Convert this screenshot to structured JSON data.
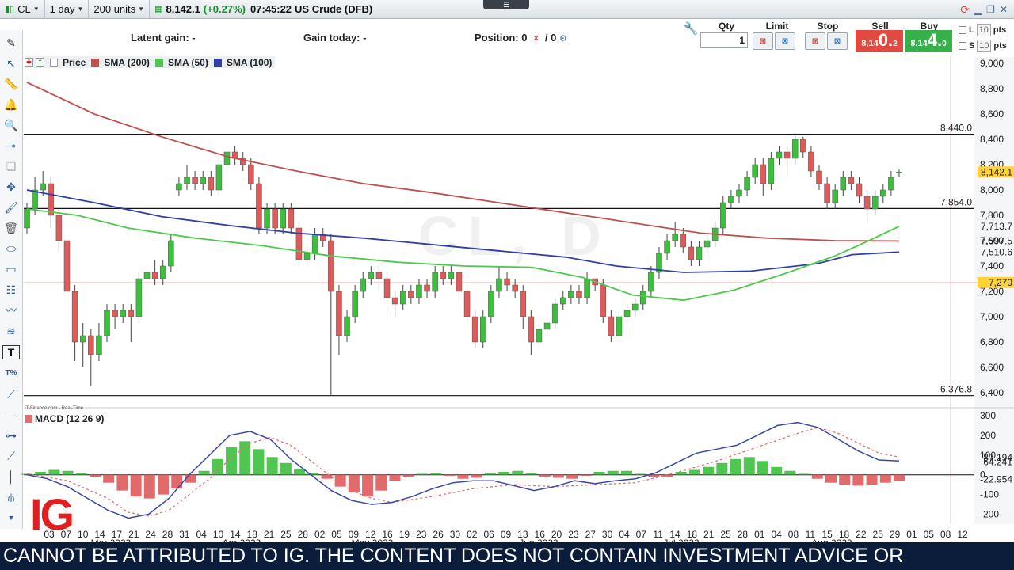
{
  "toolbar": {
    "symbol": "CL",
    "interval": "1 day",
    "units": "200 units",
    "price": "8,142.1",
    "change": "(+0.27%)",
    "time": "07:45:22",
    "market_name": "US Crude (DFB)"
  },
  "info": {
    "latent_gain": "Latent gain: -",
    "gain_today": "Gain today: -",
    "position_label": "Position: 0",
    "position_suffix": "/ 0"
  },
  "deal": {
    "qty_label": "Qty",
    "qty_value": "1",
    "limit_label": "Limit",
    "stop_label": "Stop",
    "sell_label": "Sell",
    "buy_label": "Buy",
    "sell_prefix": "8,14",
    "sell_big": "0.",
    "sell_sup": "2",
    "buy_prefix": "8,14",
    "buy_big": "4.",
    "buy_sup": "0",
    "l_label": "L",
    "s_label": "S",
    "l_value": "10",
    "s_value": "10",
    "pts": "pts"
  },
  "legend": {
    "price": "Price",
    "sma200": "SMA (200)",
    "sma50": "SMA (50)",
    "sma100": "SMA (100)",
    "macd": "MACD (12 26 9)",
    "source": "IT-Finance.com - Real-Time"
  },
  "colors": {
    "up": "#3cc03c",
    "down": "#e05a5a",
    "sma200": "#c0504d",
    "sma50": "#4cc94c",
    "sma100": "#3040a8",
    "macd_line": "#3a48a8",
    "signal_line": "#e07070",
    "accent_red": "#e04a43",
    "accent_green": "#35b04a"
  },
  "watermark": "CL, D",
  "brand": "IG",
  "ticker": "CANNOT BE ATTRIBUTED TO IG. THE CONTENT DOES NOT CONTAIN INVESTMENT ADVICE OR",
  "chart_data": {
    "type": "candlestick",
    "title": "",
    "ylim": [
      6300,
      9050
    ],
    "y_ticks": [
      6400,
      6600,
      6800,
      7000,
      7200,
      7400,
      7600,
      7800,
      8000,
      8200,
      8400,
      8600,
      8800,
      9000
    ],
    "y_tick_labels": [
      "6,400",
      "6,600",
      "6,800",
      "7,000",
      "7,200",
      "7,400",
      "7,600",
      "7,800",
      "8,000",
      "8,200",
      "8,400",
      "8,600",
      "8,800",
      "9,000"
    ],
    "x_day_labels": [
      "03",
      "07",
      "10",
      "14",
      "17",
      "21",
      "24",
      "28",
      "31",
      "04",
      "10",
      "14",
      "18",
      "21",
      "25",
      "28",
      "02",
      "05",
      "09",
      "12",
      "16",
      "19",
      "23",
      "26",
      "30",
      "02",
      "06",
      "09",
      "13",
      "16",
      "20",
      "23",
      "27",
      "30",
      "04",
      "07",
      "11",
      "14",
      "18",
      "21",
      "25",
      "28",
      "01",
      "04",
      "08",
      "11",
      "15",
      "18",
      "22",
      "25",
      "29",
      "01",
      "05",
      "08",
      "12"
    ],
    "x_month_labels": [
      "Mar 2023",
      "Apr 2023",
      "May 2023",
      "Jun 2023",
      "Jul 2023",
      "Aug 2023"
    ],
    "horizontal_lines": [
      {
        "value": 8440.0,
        "label": "8,440.0"
      },
      {
        "value": 7854.0,
        "label": "7,854.0"
      },
      {
        "value": 6376.8,
        "label": "6,376.8"
      }
    ],
    "last_values": [
      {
        "name": "Price",
        "value": 8142.1,
        "label": "8,142.1"
      },
      {
        "name": "SMA (50)",
        "value": 7713.7,
        "label": "7,713.7"
      },
      {
        "name": "SMA (200)",
        "value": 7597.5,
        "label": "7,597.5"
      },
      {
        "name": "SMA (100)",
        "value": 7510.6,
        "label": "7,510.6"
      },
      {
        "name": "",
        "value": 7270,
        "label": "7,270"
      }
    ],
    "candles": [
      [
        7700,
        7850,
        7650,
        7900
      ],
      [
        7850,
        8000,
        7800,
        8100
      ],
      [
        8000,
        8050,
        7950,
        8150
      ],
      [
        8050,
        7800,
        7700,
        8100
      ],
      [
        7800,
        7600,
        7500,
        7850
      ],
      [
        7600,
        7200,
        7100,
        7650
      ],
      [
        7200,
        6800,
        6650,
        7250
      ],
      [
        6800,
        6850,
        6600,
        6950
      ],
      [
        6850,
        6700,
        6450,
        6900
      ],
      [
        6700,
        6850,
        6650,
        6950
      ],
      [
        6850,
        7050,
        6800,
        7100
      ],
      [
        7050,
        7000,
        6900,
        7100
      ],
      [
        7000,
        7050,
        6950,
        7100
      ],
      [
        7050,
        7000,
        6800,
        7100
      ],
      [
        7000,
        7300,
        6950,
        7350
      ],
      [
        7300,
        7350,
        7250,
        7400
      ],
      [
        7350,
        7300,
        7250,
        7450
      ],
      [
        7300,
        7400,
        7250,
        7450
      ],
      [
        7400,
        7600,
        7350,
        7650
      ],
      [
        8000,
        8050,
        7950,
        8100
      ],
      [
        8050,
        8100,
        8000,
        8200
      ],
      [
        8100,
        8050,
        8000,
        8150
      ],
      [
        8050,
        8100,
        8000,
        8150
      ],
      [
        8100,
        8000,
        7950,
        8150
      ],
      [
        8000,
        8200,
        7950,
        8250
      ],
      [
        8200,
        8300,
        8150,
        8350
      ],
      [
        8300,
        8250,
        8200,
        8350
      ],
      [
        8250,
        8200,
        8150,
        8300
      ],
      [
        8200,
        8050,
        8000,
        8250
      ],
      [
        8050,
        7700,
        7650,
        8100
      ],
      [
        7700,
        7850,
        7650,
        7900
      ],
      [
        7850,
        7700,
        7650,
        7900
      ],
      [
        7700,
        7850,
        7650,
        7900
      ],
      [
        7850,
        7700,
        7650,
        7900
      ],
      [
        7700,
        7450,
        7400,
        7750
      ],
      [
        7450,
        7500,
        7400,
        7550
      ],
      [
        7500,
        7650,
        7450,
        7700
      ],
      [
        7650,
        7600,
        7550,
        7700
      ],
      [
        7600,
        7200,
        6376.8,
        7650
      ],
      [
        7200,
        6850,
        6700,
        7250
      ],
      [
        6850,
        7000,
        6800,
        7050
      ],
      [
        7000,
        7200,
        6950,
        7250
      ],
      [
        7200,
        7300,
        7150,
        7350
      ],
      [
        7300,
        7350,
        7250,
        7400
      ],
      [
        7350,
        7300,
        7200,
        7400
      ],
      [
        7300,
        7150,
        7000,
        7350
      ],
      [
        7150,
        7100,
        7000,
        7200
      ],
      [
        7100,
        7200,
        7050,
        7250
      ],
      [
        7200,
        7150,
        7100,
        7250
      ],
      [
        7150,
        7250,
        7100,
        7300
      ],
      [
        7250,
        7200,
        7150,
        7300
      ],
      [
        7200,
        7350,
        7150,
        7400
      ],
      [
        7350,
        7300,
        7250,
        7400
      ],
      [
        7300,
        7350,
        7250,
        7400
      ],
      [
        7350,
        7200,
        7150,
        7400
      ],
      [
        7200,
        7000,
        6950,
        7250
      ],
      [
        7000,
        6800,
        6750,
        7050
      ],
      [
        6800,
        7000,
        6750,
        7050
      ],
      [
        7000,
        7200,
        6950,
        7250
      ],
      [
        7200,
        7300,
        7150,
        7400
      ],
      [
        7300,
        7250,
        7200,
        7350
      ],
      [
        7250,
        7200,
        7150,
        7300
      ],
      [
        7200,
        7000,
        6900,
        7250
      ],
      [
        7000,
        6800,
        6700,
        7050
      ],
      [
        6800,
        6900,
        6750,
        6950
      ],
      [
        6900,
        6950,
        6850,
        7000
      ],
      [
        6950,
        7100,
        6900,
        7150
      ],
      [
        7100,
        7150,
        7050,
        7200
      ],
      [
        7150,
        7200,
        7100,
        7250
      ],
      [
        7200,
        7150,
        7100,
        7250
      ],
      [
        7150,
        7300,
        7100,
        7350
      ],
      [
        7300,
        7250,
        7200,
        7300
      ],
      [
        7250,
        7000,
        6950,
        7300
      ],
      [
        7000,
        6850,
        6800,
        7050
      ],
      [
        6850,
        7000,
        6800,
        7050
      ],
      [
        7000,
        7050,
        6950,
        7100
      ],
      [
        7050,
        7100,
        7000,
        7150
      ],
      [
        7100,
        7200,
        7050,
        7250
      ],
      [
        7200,
        7350,
        7150,
        7400
      ],
      [
        7350,
        7500,
        7300,
        7550
      ],
      [
        7500,
        7600,
        7450,
        7650
      ],
      [
        7600,
        7650,
        7550,
        7750
      ],
      [
        7650,
        7550,
        7500,
        7700
      ],
      [
        7550,
        7450,
        7400,
        7600
      ],
      [
        7450,
        7550,
        7400,
        7600
      ],
      [
        7550,
        7600,
        7500,
        7650
      ],
      [
        7600,
        7700,
        7550,
        7750
      ],
      [
        7700,
        7900,
        7650,
        7950
      ],
      [
        7900,
        7950,
        7850,
        8000
      ],
      [
        7950,
        8000,
        7900,
        8050
      ],
      [
        8000,
        8100,
        7950,
        8150
      ],
      [
        8100,
        8200,
        8050,
        8250
      ],
      [
        8200,
        8050,
        7950,
        8250
      ],
      [
        8050,
        8250,
        8000,
        8300
      ],
      [
        8250,
        8300,
        8200,
        8350
      ],
      [
        8300,
        8250,
        8100,
        8350
      ],
      [
        8250,
        8400,
        8200,
        8450
      ],
      [
        8400,
        8300,
        8250,
        8420
      ],
      [
        8300,
        8150,
        8100,
        8350
      ],
      [
        8150,
        8050,
        8000,
        8200
      ],
      [
        8050,
        7900,
        7850,
        8100
      ],
      [
        7900,
        8000,
        7850,
        8050
      ],
      [
        8000,
        8100,
        7950,
        8150
      ],
      [
        8100,
        8050,
        8000,
        8150
      ],
      [
        8050,
        7950,
        7900,
        8100
      ],
      [
        7950,
        7850,
        7750,
        8000
      ],
      [
        7850,
        7950,
        7800,
        8000
      ],
      [
        7950,
        8000,
        7900,
        8050
      ],
      [
        8000,
        8100,
        7950,
        8150
      ],
      [
        8142.1,
        8142.1,
        8100,
        8160
      ]
    ],
    "macd": {
      "ylim": [
        -250,
        320
      ],
      "y_ticks": [
        300,
        200,
        100,
        0,
        -100,
        -200
      ],
      "last_values": [
        {
          "name": "MACD",
          "value": 64.241,
          "label": "64.241"
        },
        {
          "name": "Signal",
          "value": 87.194,
          "label": "87.194"
        },
        {
          "name": "Histogram",
          "value": -22.954,
          "label": "-22.954"
        }
      ],
      "macd_line": [
        [
          0,
          0
        ],
        [
          5,
          -20
        ],
        [
          10,
          -60
        ],
        [
          15,
          -120
        ],
        [
          20,
          -180
        ],
        [
          25,
          -220
        ],
        [
          30,
          -200
        ],
        [
          35,
          -120
        ],
        [
          40,
          0
        ],
        [
          45,
          100
        ],
        [
          50,
          200
        ],
        [
          55,
          220
        ],
        [
          60,
          180
        ],
        [
          65,
          80
        ],
        [
          70,
          0
        ],
        [
          75,
          -80
        ],
        [
          80,
          -130
        ],
        [
          85,
          -150
        ],
        [
          90,
          -140
        ],
        [
          95,
          -110
        ],
        [
          100,
          -70
        ],
        [
          105,
          -40
        ],
        [
          110,
          -30
        ],
        [
          115,
          -30
        ],
        [
          120,
          -55
        ],
        [
          125,
          -80
        ],
        [
          130,
          -60
        ],
        [
          135,
          -30
        ],
        [
          140,
          -45
        ],
        [
          145,
          -30
        ],
        [
          150,
          -20
        ],
        [
          155,
          10
        ],
        [
          160,
          60
        ],
        [
          165,
          110
        ],
        [
          170,
          130
        ],
        [
          175,
          150
        ],
        [
          180,
          200
        ],
        [
          185,
          250
        ],
        [
          190,
          265
        ],
        [
          195,
          240
        ],
        [
          200,
          180
        ],
        [
          205,
          120
        ],
        [
          210,
          75
        ],
        [
          215,
          70
        ]
      ],
      "signal_line": [
        [
          0,
          5
        ],
        [
          10,
          -30
        ],
        [
          20,
          -120
        ],
        [
          25,
          -190
        ],
        [
          30,
          -210
        ],
        [
          35,
          -180
        ],
        [
          40,
          -100
        ],
        [
          45,
          -20
        ],
        [
          50,
          80
        ],
        [
          55,
          160
        ],
        [
          60,
          190
        ],
        [
          65,
          150
        ],
        [
          70,
          70
        ],
        [
          75,
          -10
        ],
        [
          80,
          -80
        ],
        [
          85,
          -120
        ],
        [
          90,
          -140
        ],
        [
          100,
          -110
        ],
        [
          110,
          -70
        ],
        [
          120,
          -50
        ],
        [
          130,
          -60
        ],
        [
          140,
          -50
        ],
        [
          150,
          -40
        ],
        [
          160,
          10
        ],
        [
          170,
          70
        ],
        [
          180,
          140
        ],
        [
          190,
          210
        ],
        [
          195,
          240
        ],
        [
          200,
          210
        ],
        [
          205,
          160
        ],
        [
          210,
          110
        ],
        [
          215,
          90
        ]
      ],
      "histogram": [
        5,
        15,
        25,
        20,
        10,
        -10,
        -40,
        -80,
        -110,
        -120,
        -100,
        -70,
        -40,
        20,
        80,
        140,
        170,
        130,
        90,
        60,
        30,
        10,
        -20,
        -60,
        -90,
        -110,
        -80,
        -30,
        -10,
        5,
        10,
        -5,
        -20,
        -15,
        10,
        15,
        20,
        10,
        -10,
        -15,
        -20,
        -5,
        15,
        20,
        20,
        5,
        -10,
        -10,
        15,
        25,
        40,
        60,
        80,
        90,
        70,
        40,
        20,
        5,
        -20,
        -40,
        -50,
        -55,
        -50,
        -40,
        -30
      ]
    }
  }
}
